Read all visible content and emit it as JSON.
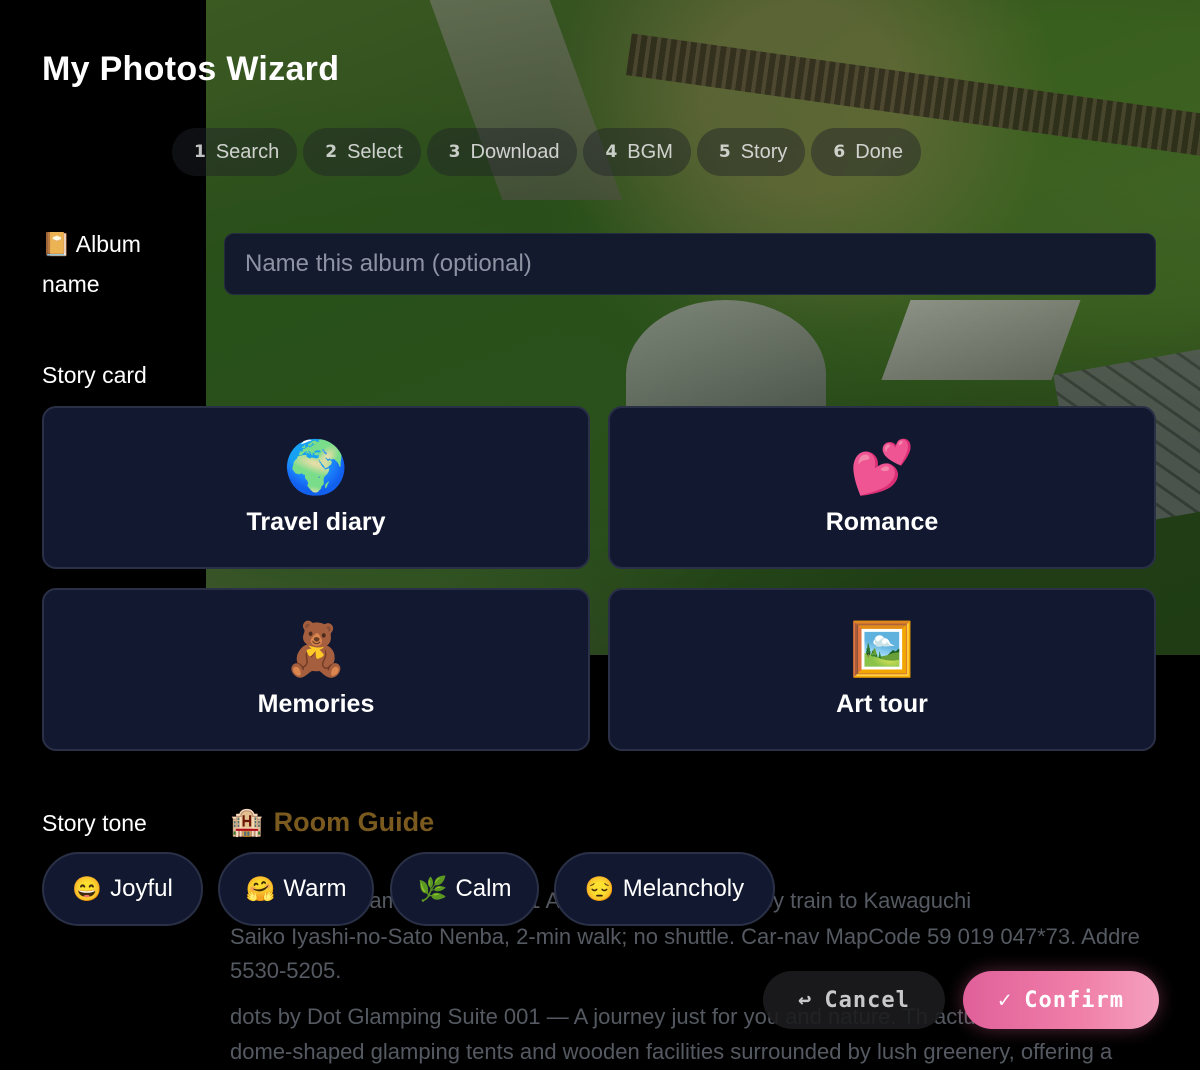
{
  "title": "My Photos Wizard",
  "steps": [
    {
      "num": "1",
      "label": "Search"
    },
    {
      "num": "2",
      "label": "Select"
    },
    {
      "num": "3",
      "label": "Download"
    },
    {
      "num": "4",
      "label": "BGM"
    },
    {
      "num": "5",
      "label": "Story"
    },
    {
      "num": "6",
      "label": "Done"
    }
  ],
  "album": {
    "icon": "📔",
    "label_line1": "Album",
    "label_line2": "name",
    "placeholder": "Name this album (optional)"
  },
  "story_card": {
    "label": "Story card",
    "cards": [
      {
        "emoji": "🌍",
        "icon_name": "globe-icon",
        "label": "Travel diary"
      },
      {
        "emoji": "💕",
        "icon_name": "hearts-icon",
        "label": "Romance"
      },
      {
        "emoji": "🧸",
        "icon_name": "teddy-bear-icon",
        "label": "Memories"
      },
      {
        "emoji": "🖼️",
        "icon_name": "framed-picture-icon",
        "label": "Art tour"
      }
    ]
  },
  "story_tone": {
    "label": "Story tone",
    "tones": [
      {
        "emoji": "😄",
        "label": "Joyful"
      },
      {
        "emoji": "🤗",
        "label": "Warm"
      },
      {
        "emoji": "🌿",
        "label": "Calm"
      },
      {
        "emoji": "😔",
        "label": "Melancholy"
      }
    ]
  },
  "background": {
    "room_icon": "🏨",
    "room_title": "Room Guide",
    "line1": "dots by Dot Glamping Suite 001 A    ... Kawaguchiko IC; by train to Kawaguchi",
    "line2": "Saiko Iyashi-no-Sato Nenba, 2-min walk; no shuttle. Car-nav MapCode 59 019 047*73. Addre",
    "line3": "5530-5205.",
    "line4": "dots by Dot Glamping Suite 001 — A journey just for you and nature. Th            actu",
    "line5": "dome-shaped glamping tents and wooden facilities surrounded by lush greenery, offering a"
  },
  "actions": {
    "cancel_icon": "↩",
    "cancel_label": "Cancel",
    "confirm_icon": "✓",
    "confirm_label": "Confirm"
  }
}
